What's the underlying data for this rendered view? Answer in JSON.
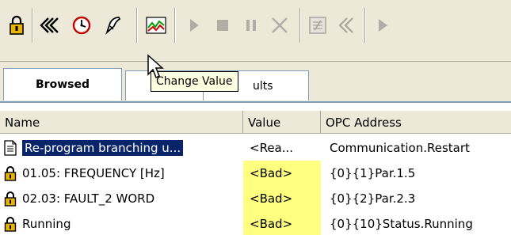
{
  "tooltip": {
    "text": "Change Value"
  },
  "tabs": [
    {
      "label": "Browsed",
      "active": true
    },
    {
      "label": "ults",
      "active": false
    }
  ],
  "columns": {
    "name": "Name",
    "value": "Value",
    "address": "OPC Address"
  },
  "rows": [
    {
      "icon": "document-icon",
      "name": "Re-program branching u...",
      "value": "<Rea...",
      "address": "Communication.Restart",
      "selected": true,
      "bad": false
    },
    {
      "icon": "lock-icon",
      "name": "01.05: FREQUENCY [Hz]",
      "value": "<Bad>",
      "address": "{0}{1}Par.1.5",
      "selected": false,
      "bad": true
    },
    {
      "icon": "lock-icon",
      "name": "02.03: FAULT_2 WORD",
      "value": "<Bad>",
      "address": "{0}{2}Par.2.3",
      "selected": false,
      "bad": true
    },
    {
      "icon": "lock-icon",
      "name": "Running",
      "value": "<Bad>",
      "address": "{0}{10}Status.Running",
      "selected": false,
      "bad": true
    }
  ],
  "colors": {
    "toolbar_bg": "#ece9d8",
    "highlight_bad": "#ffff7f",
    "selection": "#0a246a",
    "lock_gold": "#e8b400"
  }
}
